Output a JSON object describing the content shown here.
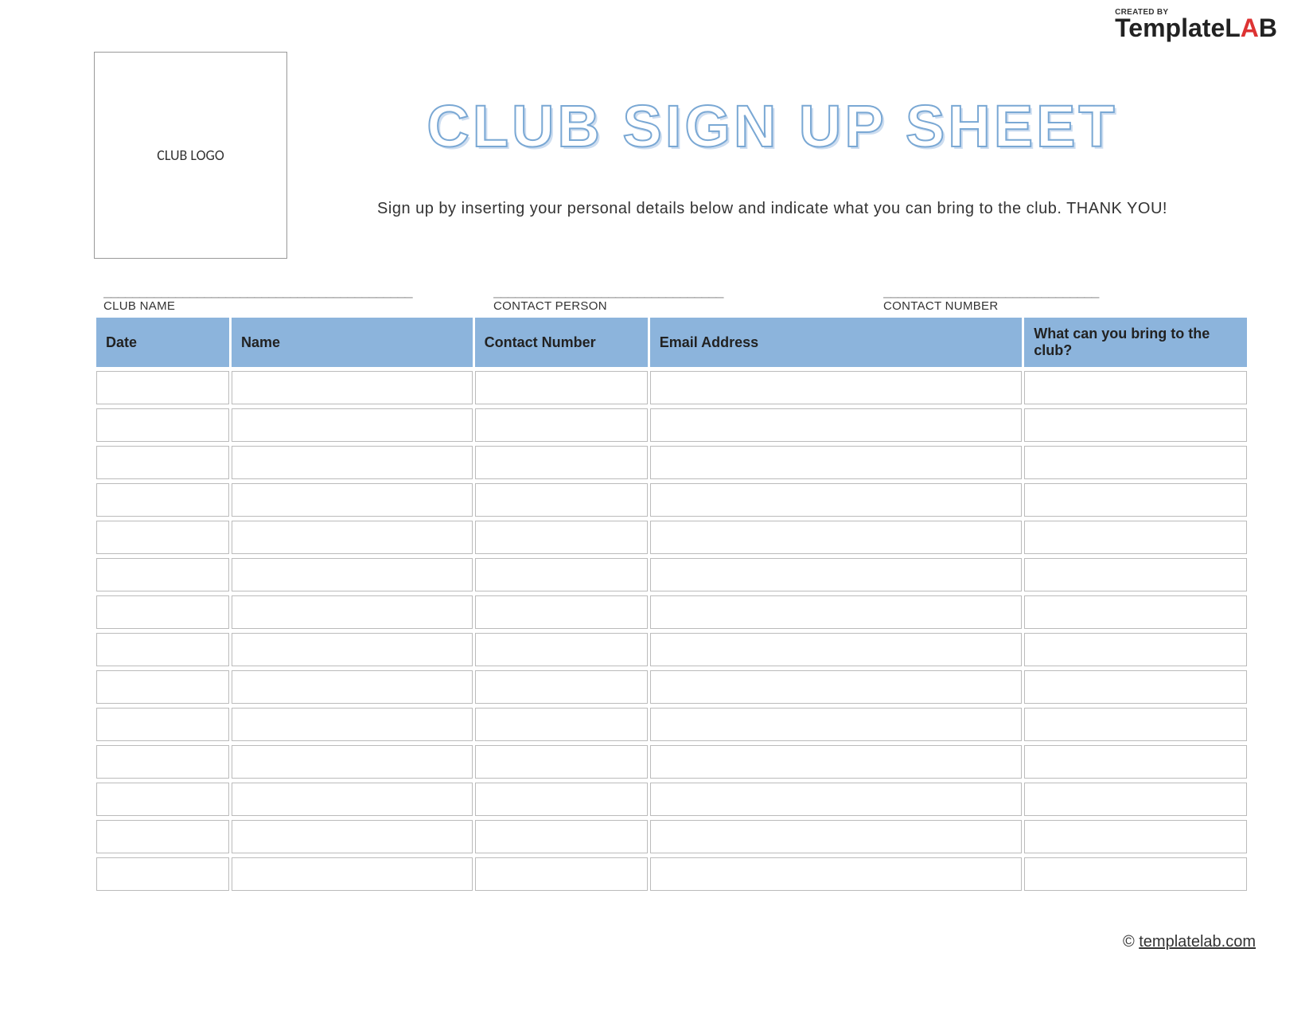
{
  "brand": {
    "created_by": "CREATED BY",
    "name_part1": "Template",
    "name_part2": "L",
    "name_part3": "A",
    "name_part4": "B"
  },
  "header": {
    "logo_placeholder": "CLUB LOGO",
    "title": "CLUB SIGN UP SHEET",
    "subtitle": "Sign up by inserting your personal details below and indicate what you can bring to the club. THANK YOU!"
  },
  "fields": {
    "club_name": {
      "line": "___________________________________________",
      "label": "CLUB NAME"
    },
    "contact_person": {
      "line": "________________________________",
      "label": "CONTACT PERSON"
    },
    "contact_number": {
      "line": "______________________________",
      "label": "CONTACT NUMBER"
    }
  },
  "table": {
    "columns": [
      "Date",
      "Name",
      "Contact Number",
      "Email Address",
      "What can you bring to the club?"
    ],
    "rows": [
      [
        "",
        "",
        "",
        "",
        ""
      ],
      [
        "",
        "",
        "",
        "",
        ""
      ],
      [
        "",
        "",
        "",
        "",
        ""
      ],
      [
        "",
        "",
        "",
        "",
        ""
      ],
      [
        "",
        "",
        "",
        "",
        ""
      ],
      [
        "",
        "",
        "",
        "",
        ""
      ],
      [
        "",
        "",
        "",
        "",
        ""
      ],
      [
        "",
        "",
        "",
        "",
        ""
      ],
      [
        "",
        "",
        "",
        "",
        ""
      ],
      [
        "",
        "",
        "",
        "",
        ""
      ],
      [
        "",
        "",
        "",
        "",
        ""
      ],
      [
        "",
        "",
        "",
        "",
        ""
      ],
      [
        "",
        "",
        "",
        "",
        ""
      ],
      [
        "",
        "",
        "",
        "",
        ""
      ]
    ]
  },
  "footer": {
    "copyright": "©",
    "link_text": "templatelab.com"
  }
}
